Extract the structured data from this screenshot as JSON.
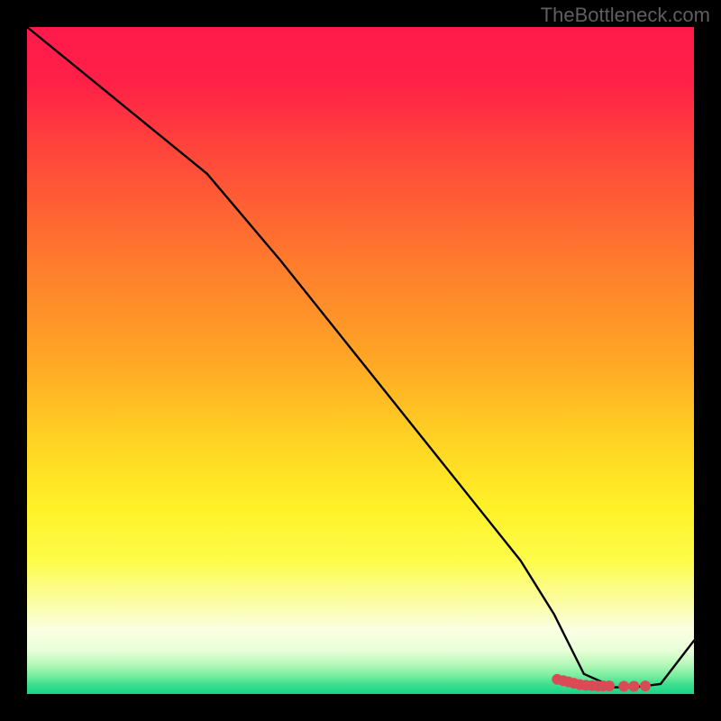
{
  "watermark": "TheBottleneck.com",
  "chart_data": {
    "type": "line",
    "title": "",
    "xlabel": "",
    "ylabel": "",
    "xlim": [
      0,
      100
    ],
    "ylim": [
      0,
      100
    ],
    "x": [
      0,
      27,
      38,
      50,
      62,
      74,
      79,
      83.5,
      88,
      91,
      95,
      100
    ],
    "values": [
      100,
      78,
      65,
      50,
      35,
      20,
      12,
      3,
      1,
      1,
      1.5,
      8
    ],
    "markers": {
      "x": [
        79.5,
        80.4,
        81.2,
        82.0,
        82.9,
        83.8,
        84.7,
        85.6,
        86.4,
        87.3,
        89.5,
        91.0,
        92.7
      ],
      "y": [
        2.2,
        2.0,
        1.8,
        1.6,
        1.4,
        1.3,
        1.25,
        1.2,
        1.2,
        1.2,
        1.15,
        1.15,
        1.2
      ],
      "color": "#d94b55",
      "radius": 6
    },
    "gradient_stops": [
      {
        "offset": 0,
        "color": "#ff1a4b"
      },
      {
        "offset": 0.08,
        "color": "#ff2047"
      },
      {
        "offset": 0.2,
        "color": "#ff4a3a"
      },
      {
        "offset": 0.35,
        "color": "#ff7a2d"
      },
      {
        "offset": 0.5,
        "color": "#ffa725"
      },
      {
        "offset": 0.62,
        "color": "#ffd323"
      },
      {
        "offset": 0.72,
        "color": "#fff128"
      },
      {
        "offset": 0.8,
        "color": "#fdfc4a"
      },
      {
        "offset": 0.86,
        "color": "#fbfda0"
      },
      {
        "offset": 0.905,
        "color": "#faffe4"
      },
      {
        "offset": 0.935,
        "color": "#e8ffd8"
      },
      {
        "offset": 0.955,
        "color": "#b7f9b9"
      },
      {
        "offset": 0.972,
        "color": "#7beea0"
      },
      {
        "offset": 0.985,
        "color": "#3fe08f"
      },
      {
        "offset": 1.0,
        "color": "#18d487"
      }
    ]
  }
}
